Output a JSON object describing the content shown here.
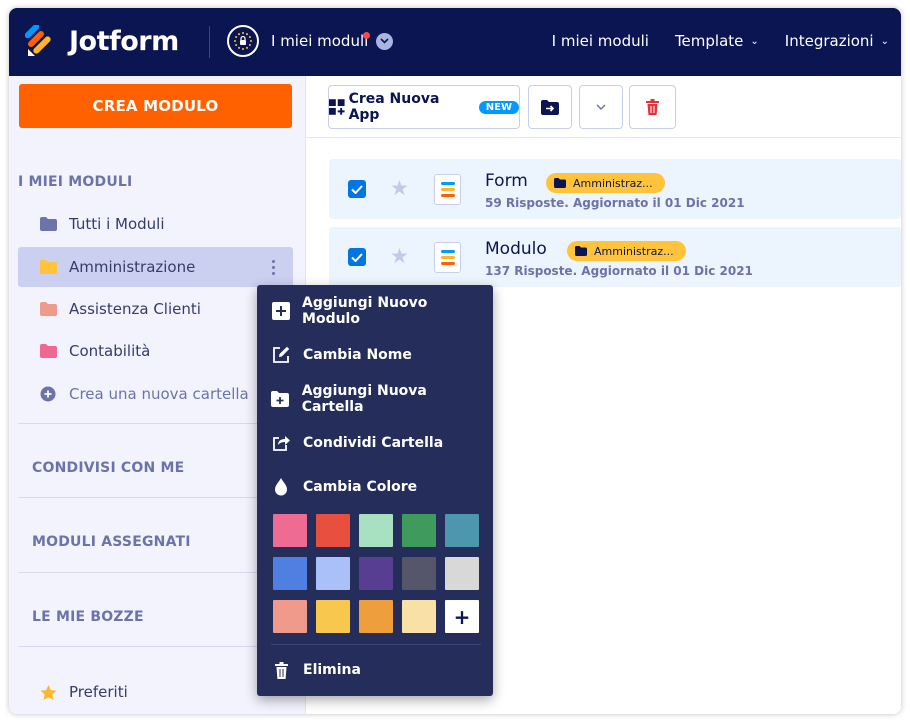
{
  "header": {
    "logo_text": "Jotform",
    "workspace_label": "I miei moduli",
    "nav": [
      {
        "label": "I miei moduli",
        "has_caret": false
      },
      {
        "label": "Template",
        "has_caret": true
      },
      {
        "label": "Integrazioni",
        "has_caret": true
      }
    ],
    "caret": "⌄"
  },
  "sidebar": {
    "create_button": "CREA MODULO",
    "my_forms_header": "I MIEI MODULI",
    "items": [
      {
        "label": "Tutti i Moduli",
        "icon": "folder-icon",
        "color": "#6c73a8"
      },
      {
        "label": "Amministrazione",
        "icon": "folder-icon",
        "color": "#ffc43c"
      },
      {
        "label": "Assistenza Clienti",
        "icon": "folder-icon",
        "color": "#f09a8c"
      },
      {
        "label": "Contabilità",
        "icon": "folder-icon",
        "color": "#f0678f"
      }
    ],
    "create_folder": "Crea una nuova cartella",
    "shared_header": "CONDIVISI CON ME",
    "assigned_header": "MODULI ASSEGNATI",
    "drafts_header": "LE MIE BOZZE",
    "favorites": "Preferiti"
  },
  "toolbar": {
    "create_app": "Crea Nuova App",
    "new_badge": "NEW"
  },
  "forms": [
    {
      "title": "Form",
      "folder_tag": "Amministraz...",
      "meta": "59 Risposte. Aggiornato il 01 Dic 2021",
      "checked": true
    },
    {
      "title": "Modulo",
      "folder_tag": "Amministraz...",
      "meta": "137 Risposte. Aggiornato il 01 Dic 2021",
      "checked": true
    }
  ],
  "context_menu": {
    "add_form": "Aggiungi Nuovo Modulo",
    "rename": "Cambia Nome",
    "add_folder": "Aggiungi Nuova Cartella",
    "share": "Condividi Cartella",
    "change_color": "Cambia Colore",
    "delete": "Elimina",
    "plus": "+",
    "colors": [
      "#ee6b93",
      "#e84f3e",
      "#a7e1c1",
      "#3f9a5e",
      "#4c97ae",
      "#4f7fe0",
      "#a9c0f8",
      "#583e92",
      "#55566a",
      "#d8d8d8",
      "#f09a8c",
      "#f8c74d",
      "#ef9e3c",
      "#f9e0a6"
    ]
  },
  "colors": {
    "header_bg": "#0a1551",
    "accent_orange": "#ff6100",
    "checkbox_blue": "#0075e3",
    "menu_bg": "#252d5b"
  }
}
